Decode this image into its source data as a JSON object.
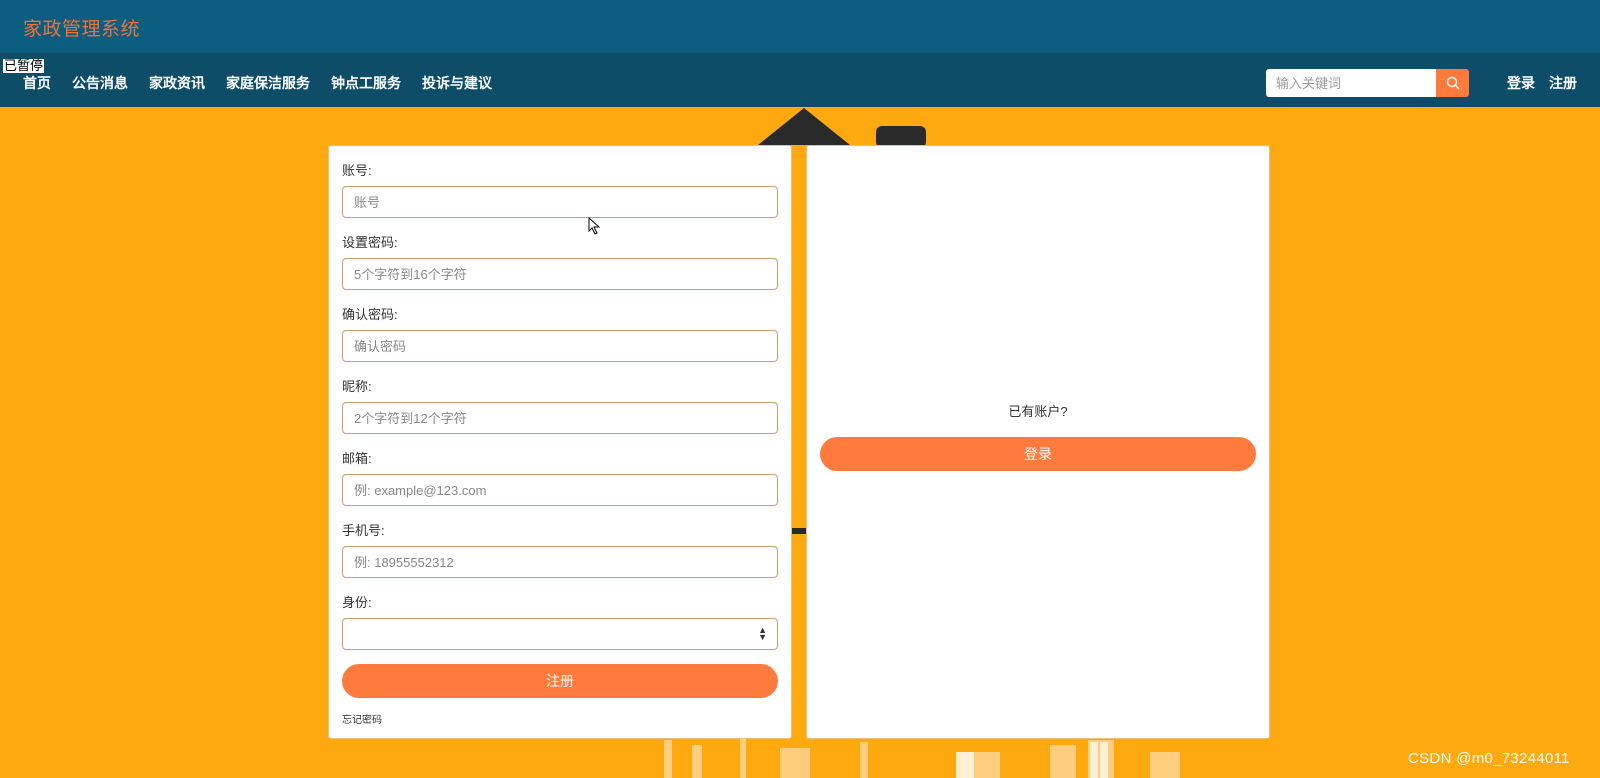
{
  "app": {
    "title": "家政管理系统",
    "paused_label": "已暂停"
  },
  "nav": {
    "items": [
      {
        "label": "首页"
      },
      {
        "label": "公告消息"
      },
      {
        "label": "家政资讯"
      },
      {
        "label": "家庭保洁服务"
      },
      {
        "label": "钟点工服务"
      },
      {
        "label": "投诉与建议"
      }
    ],
    "search_placeholder": "输入关键词",
    "login": "登录",
    "register": "注册"
  },
  "form": {
    "account_label": "账号:",
    "account_placeholder": "账号",
    "password_label": "设置密码:",
    "password_placeholder": "5个字符到16个字符",
    "confirm_label": "确认密码:",
    "confirm_placeholder": "确认密码",
    "nickname_label": "昵称:",
    "nickname_placeholder": "2个字符到12个字符",
    "email_label": "邮箱:",
    "email_placeholder": "例: example@123.com",
    "phone_label": "手机号:",
    "phone_placeholder": "例: 18955552312",
    "role_label": "身份:",
    "role_value": "",
    "submit": "注册",
    "forgot": "忘记密码"
  },
  "side": {
    "has_account": "已有账户?",
    "login_button": "登录"
  },
  "watermark": "CSDN @m0_73244011",
  "colors": {
    "top_bar": "#0B5E7F",
    "nav_bar": "#0E4D68",
    "background": "#FDA90F",
    "accent": "#FF7A3D",
    "brand_text": "#F26F3A"
  }
}
